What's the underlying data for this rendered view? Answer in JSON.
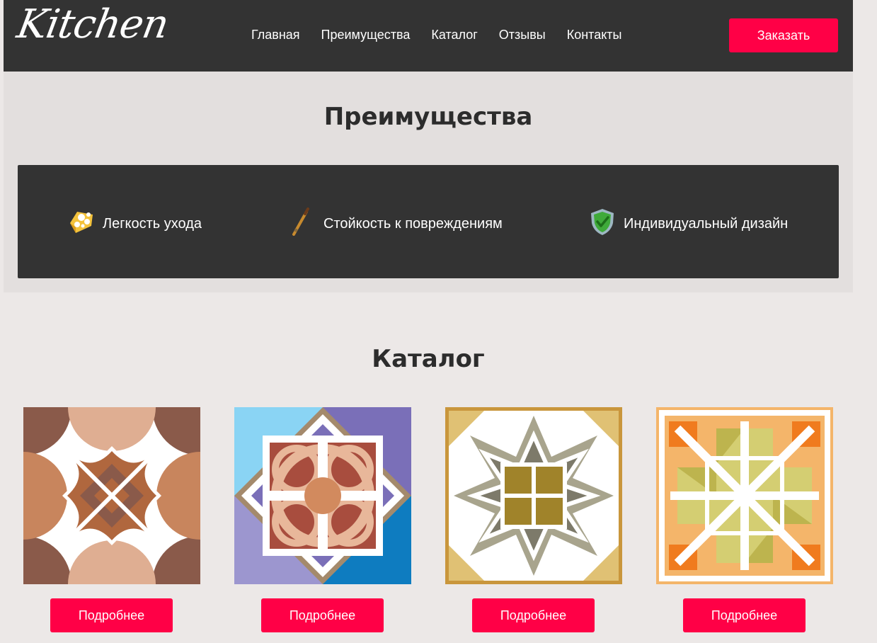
{
  "header": {
    "logo": "Kitchen",
    "nav": [
      "Главная",
      "Преимущества",
      "Каталог",
      "Отзывы",
      "Контакты"
    ],
    "order_button": "Заказать"
  },
  "advantages": {
    "title": "Преимущества",
    "items": [
      {
        "icon": "sponge-icon",
        "label": "Легкость ухода"
      },
      {
        "icon": "brush-icon",
        "label": "Стойкость к повреждениям"
      },
      {
        "icon": "shield-check-icon",
        "label": "Индивидуальный дизайн"
      }
    ]
  },
  "catalog": {
    "title": "Каталог",
    "items": [
      {
        "name": "tile-brown-circles",
        "button": "Подробнее"
      },
      {
        "name": "tile-blue-purple-mosaic",
        "button": "Подробнее"
      },
      {
        "name": "tile-olive-star",
        "button": "Подробнее"
      },
      {
        "name": "tile-orange-yellow-geometric",
        "button": "Подробнее"
      }
    ]
  },
  "colors": {
    "accent": "#ff0046",
    "header_bg": "#333333",
    "page_bg": "#ece8e7"
  }
}
